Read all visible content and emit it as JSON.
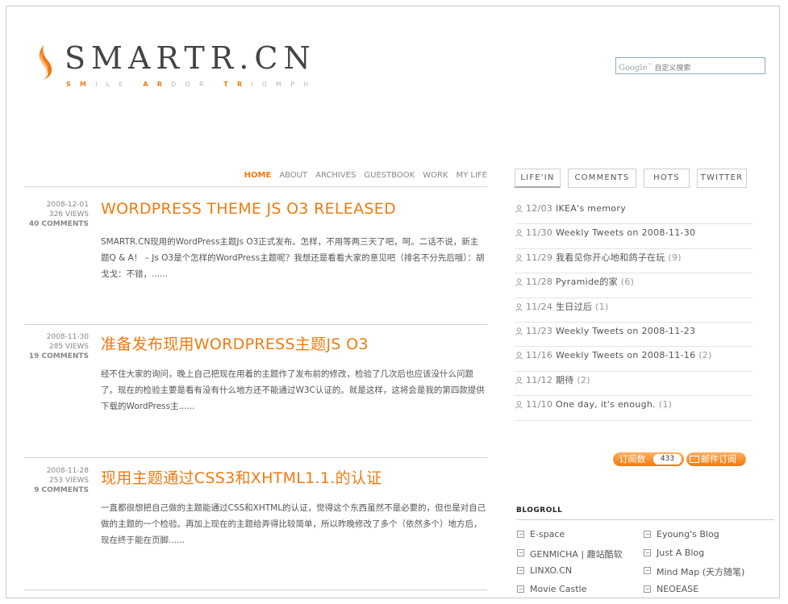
{
  "logo": {
    "text": "SMARTR.CN",
    "tagline": [
      "S",
      "M",
      "I",
      "L",
      "E",
      ".",
      "A",
      "R",
      "D",
      "O",
      "R",
      ".",
      "T",
      "R",
      "I",
      "U",
      "M",
      "P",
      "H"
    ],
    "tagline_highlight": [
      0,
      1,
      6,
      7,
      12,
      13
    ]
  },
  "search": {
    "placeholder": "自定义搜索",
    "engine": "Google"
  },
  "nav": [
    "HOME",
    "ABOUT",
    "ARCHIVES",
    "GUESTBOOK",
    "WORK",
    "MY LIFE"
  ],
  "posts": [
    {
      "date": "2008-12-01",
      "views": "326 VIEWS",
      "comments": "40 COMMENTS",
      "title": "WORDPRESS THEME JS O3 RELEASED",
      "excerpt": "SMARTR.CN现用的WordPress主题Js O3正式发布。怎样，不用等两三天了吧，呵。二话不说，新主题Q & A！ – Js O3是个怎样的WordPress主题呢？我想还是看看大家的意见吧（排名不分先后哦）：胡戈戈：不错，......"
    },
    {
      "date": "2008-11-30",
      "views": "285 VIEWS",
      "comments": "19 COMMENTS",
      "title": "准备发布现用WORDPRESS主题JS O3",
      "excerpt": "经不住大家的询问，晚上自己把现在用着的主题作了发布前的修改，检验了几次后也应该没什么问题了。现在的检验主要是看有没有什么地方还不能通过W3C认证的。就是这样，这将会是我的第四款提供下载的WordPress主......"
    },
    {
      "date": "2008-11-28",
      "views": "253 VIEWS",
      "comments": "9 COMMENTS",
      "title": "现用主题通过CSS3和XHTML1.1.的认证",
      "excerpt": "一直都很想把自己做的主题能通过CSS和XHTML的认证，觉得这个东西虽然不是必要的，但也是对自己做的主题的一个检验。再加上现在的主题给弄得比较简单，所以昨晚修改了多个（依然多个）地方后，现在终于能在页脚......"
    }
  ],
  "tabs": [
    "LIFE'IN",
    "COMMENTS",
    "HOTS",
    "TWITTER"
  ],
  "recent": [
    {
      "date": "12/03",
      "title": "IKEA's memory",
      "count": ""
    },
    {
      "date": "11/30",
      "title": "Weekly Tweets on 2008-11-30",
      "count": ""
    },
    {
      "date": "11/29",
      "title": "我看见你开心地和鸽子在玩",
      "count": "(9)"
    },
    {
      "date": "11/28",
      "title": "Pyramide的家",
      "count": "(6)"
    },
    {
      "date": "11/24",
      "title": "生日过后",
      "count": "(1)"
    },
    {
      "date": "11/23",
      "title": "Weekly Tweets on 2008-11-23",
      "count": ""
    },
    {
      "date": "11/16",
      "title": "Weekly Tweets on 2008-11-16",
      "count": "(2)"
    },
    {
      "date": "11/12",
      "title": "期待",
      "count": "(2)"
    },
    {
      "date": "11/10",
      "title": "One day, it's enough.",
      "count": "(1)"
    }
  ],
  "subscribe": {
    "label": "订阅数",
    "count": "433",
    "mail_label": "邮件订阅"
  },
  "blogroll": {
    "title": "BLOGROLL",
    "links": [
      "E-space",
      "Eyoung's Blog",
      "GENMICHA | 趣站酷软",
      "Just A Blog",
      "LINXO.CN",
      "Mind Map (天方随笔)",
      "Movie Castle",
      "NEOEASE"
    ]
  },
  "colors": {
    "accent": "#f07a10",
    "text": "#555555",
    "muted": "#888888"
  }
}
